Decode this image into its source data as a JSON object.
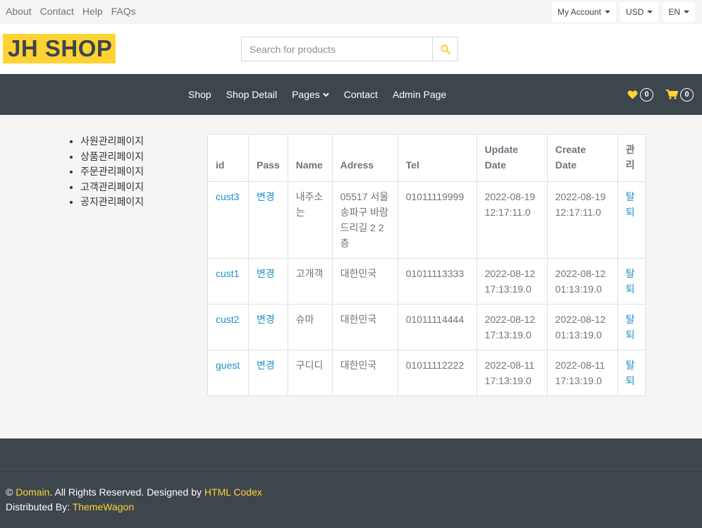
{
  "topbar": {
    "links": [
      "About",
      "Contact",
      "Help",
      "FAQs"
    ],
    "account": "My Account",
    "currency": "USD",
    "language": "EN"
  },
  "header": {
    "logo": "JH SHOP",
    "search_placeholder": "Search for products"
  },
  "nav": {
    "items": [
      "Shop",
      "Shop Detail",
      "Pages",
      "Contact",
      "Admin Page"
    ],
    "wishlist_count": "0",
    "cart_count": "0"
  },
  "sidebar": {
    "items": [
      "사원관리페이지",
      "상품관리페이지",
      "주문관리페이지",
      "고객관리페이지",
      "공지관리페이지"
    ]
  },
  "table": {
    "headers": [
      "id",
      "Pass",
      "Name",
      "Adress",
      "Tel",
      "Update Date",
      "Create Date",
      "관리"
    ],
    "rows": [
      {
        "id": "cust3",
        "pass": "변경",
        "name": "내주소는",
        "address": "05517 서울 송파구 바람드리길 2 2층",
        "tel": "01011119999",
        "update": "2022-08-19 12:17:11.0",
        "create": "2022-08-19 12:17:11.0",
        "manage": "탈퇴"
      },
      {
        "id": "cust1",
        "pass": "변경",
        "name": "고개객",
        "address": "대한민국",
        "tel": "01011113333",
        "update": "2022-08-12 17:13:19.0",
        "create": "2022-08-12 01:13:19.0",
        "manage": "탈퇴"
      },
      {
        "id": "cust2",
        "pass": "변경",
        "name": "슈마",
        "address": "대한민국",
        "tel": "01011114444",
        "update": "2022-08-12 17:13:19.0",
        "create": "2022-08-12 01:13:19.0",
        "manage": "탈퇴"
      },
      {
        "id": "guest",
        "pass": "변경",
        "name": "구디디",
        "address": "대한민국",
        "tel": "01011112222",
        "update": "2022-08-11 17:13:19.0",
        "create": "2022-08-11 17:13:19.0",
        "manage": "탈퇴"
      }
    ]
  },
  "footer": {
    "copy_symbol": "©",
    "domain": "Domain",
    "rights": ". All Rights Reserved. Designed by",
    "designer": "HTML Codex",
    "distributed": "Distributed By:",
    "distributor": "ThemeWagon"
  },
  "colors": {
    "accent": "#ffd333",
    "dark": "#3d464d",
    "link": "#1e90c8"
  }
}
